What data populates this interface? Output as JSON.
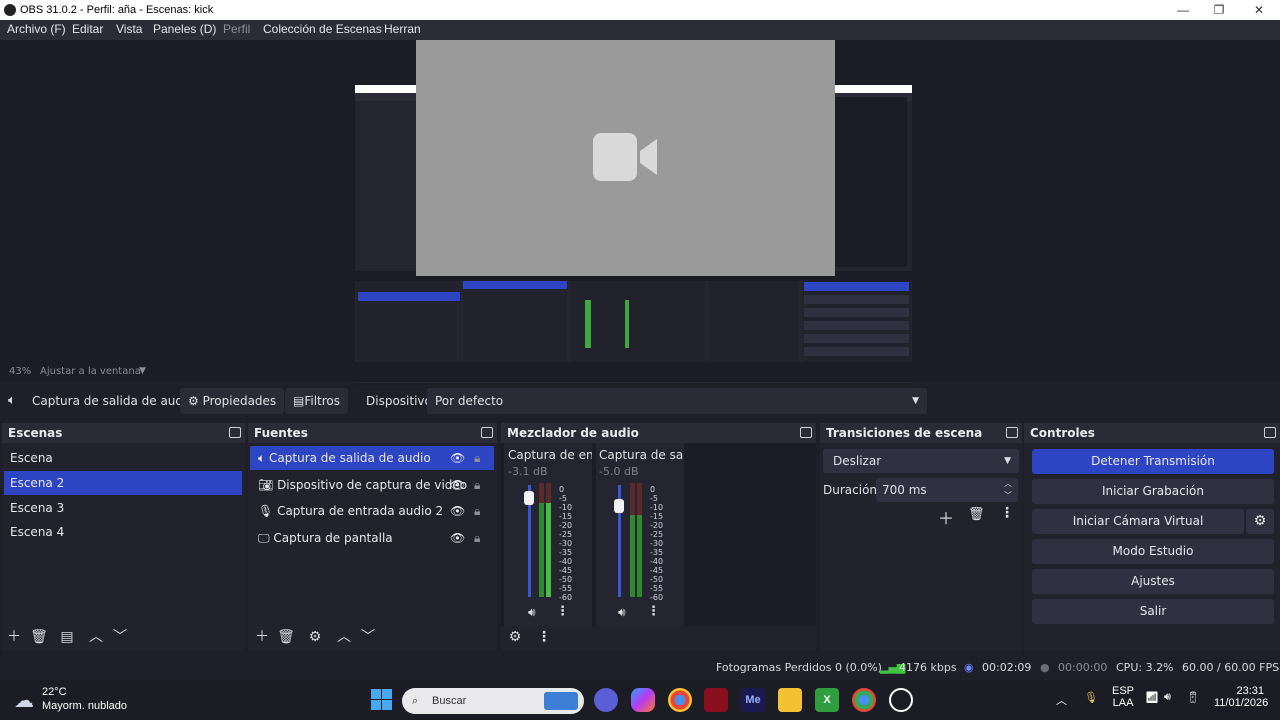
{
  "window": {
    "title": "OBS 31.0.2 - Perfil: aña - Escenas: kick",
    "minimize": "—",
    "maximize": "❐",
    "close": "✕"
  },
  "menu": [
    "Archivo (F)",
    "Editar",
    "Vista",
    "Paneles (D)",
    "Perfil",
    "Colección de Escenas",
    "Herran"
  ],
  "zoom": {
    "percent": "43%",
    "fit_label": "Ajustar a la ventana"
  },
  "source_toolbar": {
    "source_name": "Captura de salida de audio",
    "properties": "Propiedades",
    "filters": "Filtros",
    "device_label": "Dispositivo",
    "device_value": "Por defecto"
  },
  "scenes": {
    "title": "Escenas",
    "items": [
      "Escena",
      "Escena 2",
      "Escena 3",
      "Escena 4"
    ],
    "selected_index": 1
  },
  "sources": {
    "title": "Fuentes",
    "items": [
      {
        "label": "Captura de salida de audio",
        "icon": "speaker-icon"
      },
      {
        "label": "Dispositivo de captura de video",
        "icon": "camera-icon"
      },
      {
        "label": "Captura de entrada audio 2",
        "icon": "mic-icon"
      },
      {
        "label": "Captura de pantalla",
        "icon": "monitor-icon"
      }
    ],
    "selected_index": 0
  },
  "mixer": {
    "title": "Mezclador de audio",
    "channels": [
      {
        "name": "Captura de entra",
        "db": "-3.1 dB",
        "fader_level": 0.88
      },
      {
        "name": "Captura de salid",
        "db": "-5.0 dB",
        "fader_level": 0.81
      }
    ],
    "scale": [
      "0",
      "-5",
      "-10",
      "-15",
      "-20",
      "-25",
      "-30",
      "-35",
      "-40",
      "-45",
      "-50",
      "-55",
      "-60"
    ]
  },
  "transitions": {
    "title": "Transiciones de escena",
    "type": "Deslizar",
    "duration_label": "Duración",
    "duration_value": "700 ms"
  },
  "controls": {
    "title": "Controles",
    "buttons": [
      "Detener Transmisión",
      "Iniciar Grabación",
      "Iniciar Cámara Virtual",
      "Modo Estudio",
      "Ajustes",
      "Salir"
    ]
  },
  "status": {
    "dropped": "Fotogramas Perdidos 0 (0.0%)",
    "bitrate": "4176 kbps",
    "stream_time": "00:02:09",
    "rec_time": "00:00:00",
    "cpu": "CPU: 3.2%",
    "fps": "60.00 / 60.00 FPS"
  },
  "taskbar": {
    "weather_temp": "22°C",
    "weather_desc": "Mayorm. nublado",
    "search_placeholder": "Buscar",
    "lang_line1": "ESP",
    "lang_line2": "LAA",
    "time": "23:31",
    "date": "11/01/2026"
  },
  "colors": {
    "accent": "#2d44c3",
    "bg": "#1e1f29",
    "panel": "#21222c",
    "header": "#2a2b36"
  }
}
